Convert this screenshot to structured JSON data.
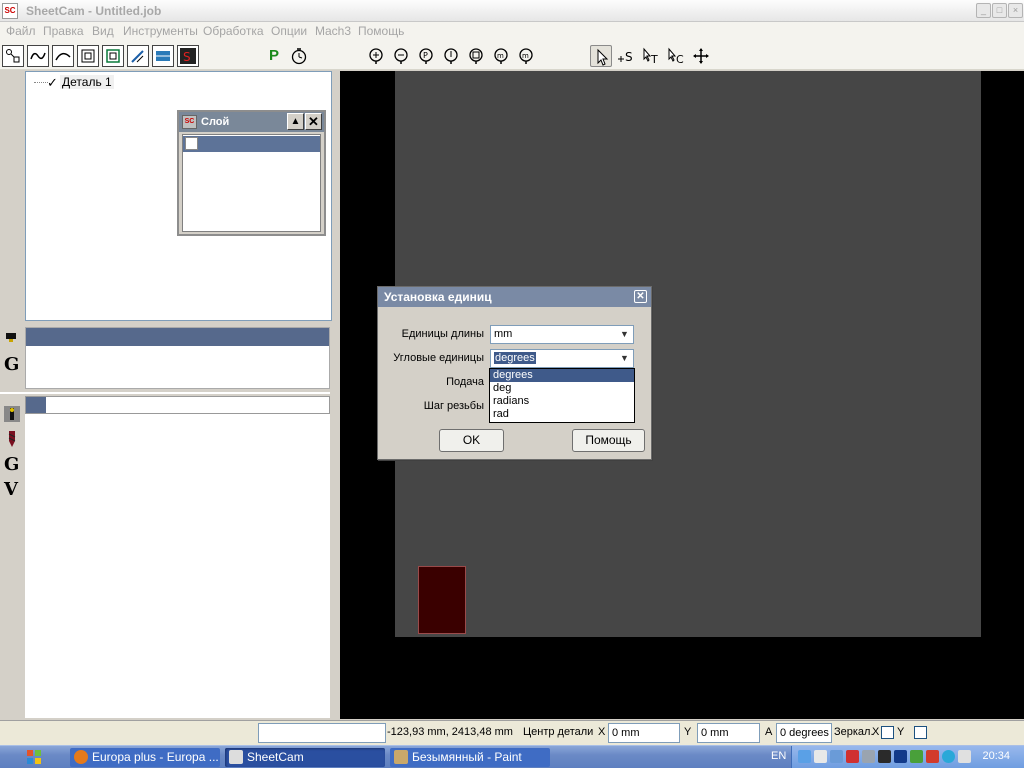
{
  "window": {
    "title": "SheetCam - Untitled.job",
    "app_icon": "sc-app-icon"
  },
  "menu": [
    "Файл",
    "Правка",
    "Вид",
    "Инструменты",
    "Обработка",
    "Опции",
    "Mach3",
    "Помощь"
  ],
  "toolbar": {
    "post_label": "P",
    "zoom_icons": [
      "zoom-in-icon",
      "zoom-out-icon",
      "zoom-fit-icon",
      "zoom-part-icon",
      "zoom-window-icon",
      "zoom-sheet-icon",
      "zoom-toolpath-icon"
    ]
  },
  "tree": {
    "root": "Деталь 1"
  },
  "layer_window": {
    "title": "Слой"
  },
  "side_glyphs": {
    "g": "G",
    "v": "V"
  },
  "dialog": {
    "title": "Установка единиц",
    "fields": [
      {
        "label": "Единицы длины",
        "value": "mm"
      },
      {
        "label": "Угловые единицы",
        "value": "degrees"
      },
      {
        "label": "Подача"
      },
      {
        "label": "Шаг резьбы"
      }
    ],
    "dropdown_options": [
      "degrees",
      "deg",
      "radians",
      "rad"
    ],
    "ok_label": "OK",
    "help_label": "Помощь"
  },
  "status": {
    "coords": "-123,93 mm, 2413,48 mm",
    "center_label": "Центр детали",
    "x_label": "X",
    "x_value": "0 mm",
    "y_label": "Y",
    "y_value": "0 mm",
    "a_label": "A",
    "a_value": "0 degrees",
    "mirror_label": "Зеркал.",
    "mirror_x": "X",
    "mirror_y": "Y"
  },
  "taskbar": {
    "tasks": [
      {
        "label": "Europa plus - Europa ...",
        "icon": "firefox-icon"
      },
      {
        "label": "SheetCam",
        "icon": "sheetcam-icon"
      },
      {
        "label": "Безымянный - Paint",
        "icon": "paint-icon"
      }
    ],
    "lang": "EN",
    "clock": "20:34"
  },
  "colors": {
    "canvas": "#000000",
    "sheet": "#464646",
    "part": "#3a0000",
    "selection": "#56698c"
  }
}
